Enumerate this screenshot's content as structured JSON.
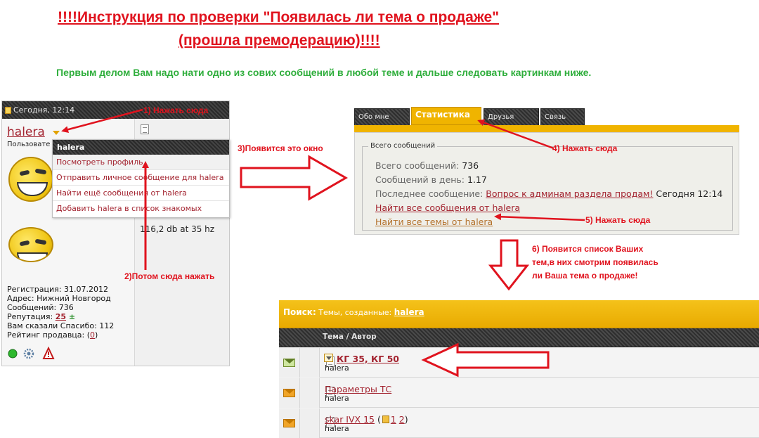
{
  "heading": {
    "line1": "!!!!Инструкция по проверки \"Появилась ли тема о продаже\"",
    "line2": "(прошла премодерацию)!!!!",
    "note": "Первым делом Вам надо нати одно из сових сообщений в любой теме и дальше следовать картинкам ниже."
  },
  "post": {
    "date": "Сегодня, 12:14",
    "username": "halera",
    "role": "Пользовате",
    "signature": "116,2 db at 35 hz",
    "stats": {
      "registration": "Регистрация: 31.07.2012",
      "address": "Адрес: Нижний Новгород",
      "messages": "Сообщений: 736",
      "reputation_label": "Репутация: ",
      "reputation_value": "25",
      "reputation_sign": " ±",
      "thanks": "Вам сказали Спасибо: 112",
      "seller_label": "Рейтинг продавца: (",
      "seller_value": "0",
      "seller_close": ")"
    },
    "menu": {
      "header": "halera",
      "items": [
        "Посмотреть профиль",
        "Отправить личное сообщение для halera",
        "Найти ещё сообщения от halera",
        "Добавить halera в список знакомых"
      ]
    }
  },
  "profile": {
    "tabs": [
      "Обо мне",
      "Статистика",
      "Друзья",
      "Связь"
    ],
    "legend": "Всего сообщений",
    "total_label": "Всего сообщений: ",
    "total_value": "736",
    "perday_label": "Сообщений в день: ",
    "perday_value": "1.17",
    "last_label": "Последнее сообщение: ",
    "last_link": "Вопрос к админам раздела продам!",
    "last_time": " Сегодня 12:14",
    "find_posts": "Найти все сообщения от halera",
    "find_threads": "Найти все темы от halera"
  },
  "search": {
    "label": "Поиск:",
    "text": " Темы, созданные: ",
    "user": "halera",
    "column": "Тема / Автор",
    "rows": [
      {
        "title": "КГ 35, КГ 50",
        "author": "halera"
      },
      {
        "title": "Параметры ТС",
        "author": "halera"
      },
      {
        "title": "skar IVX 15",
        "author": "halera",
        "pages": [
          "1",
          "2"
        ]
      }
    ]
  },
  "annotations": {
    "step1": "1) Нажать сюда",
    "step2": "2)Потом сюда нажать",
    "step3": "3)Появится это окно",
    "step4": "4) Нажать сюда",
    "step5": "5) Нажать сюда",
    "step6": "6) Появится список Ваших тем,в них смотрим появилась ли Ваша тема о продаже!"
  },
  "colors": {
    "instruction_red": "#e0131e",
    "note_green": "#2fae3c",
    "forum_gold": "#f0b400",
    "link_red": "#a3232f"
  }
}
